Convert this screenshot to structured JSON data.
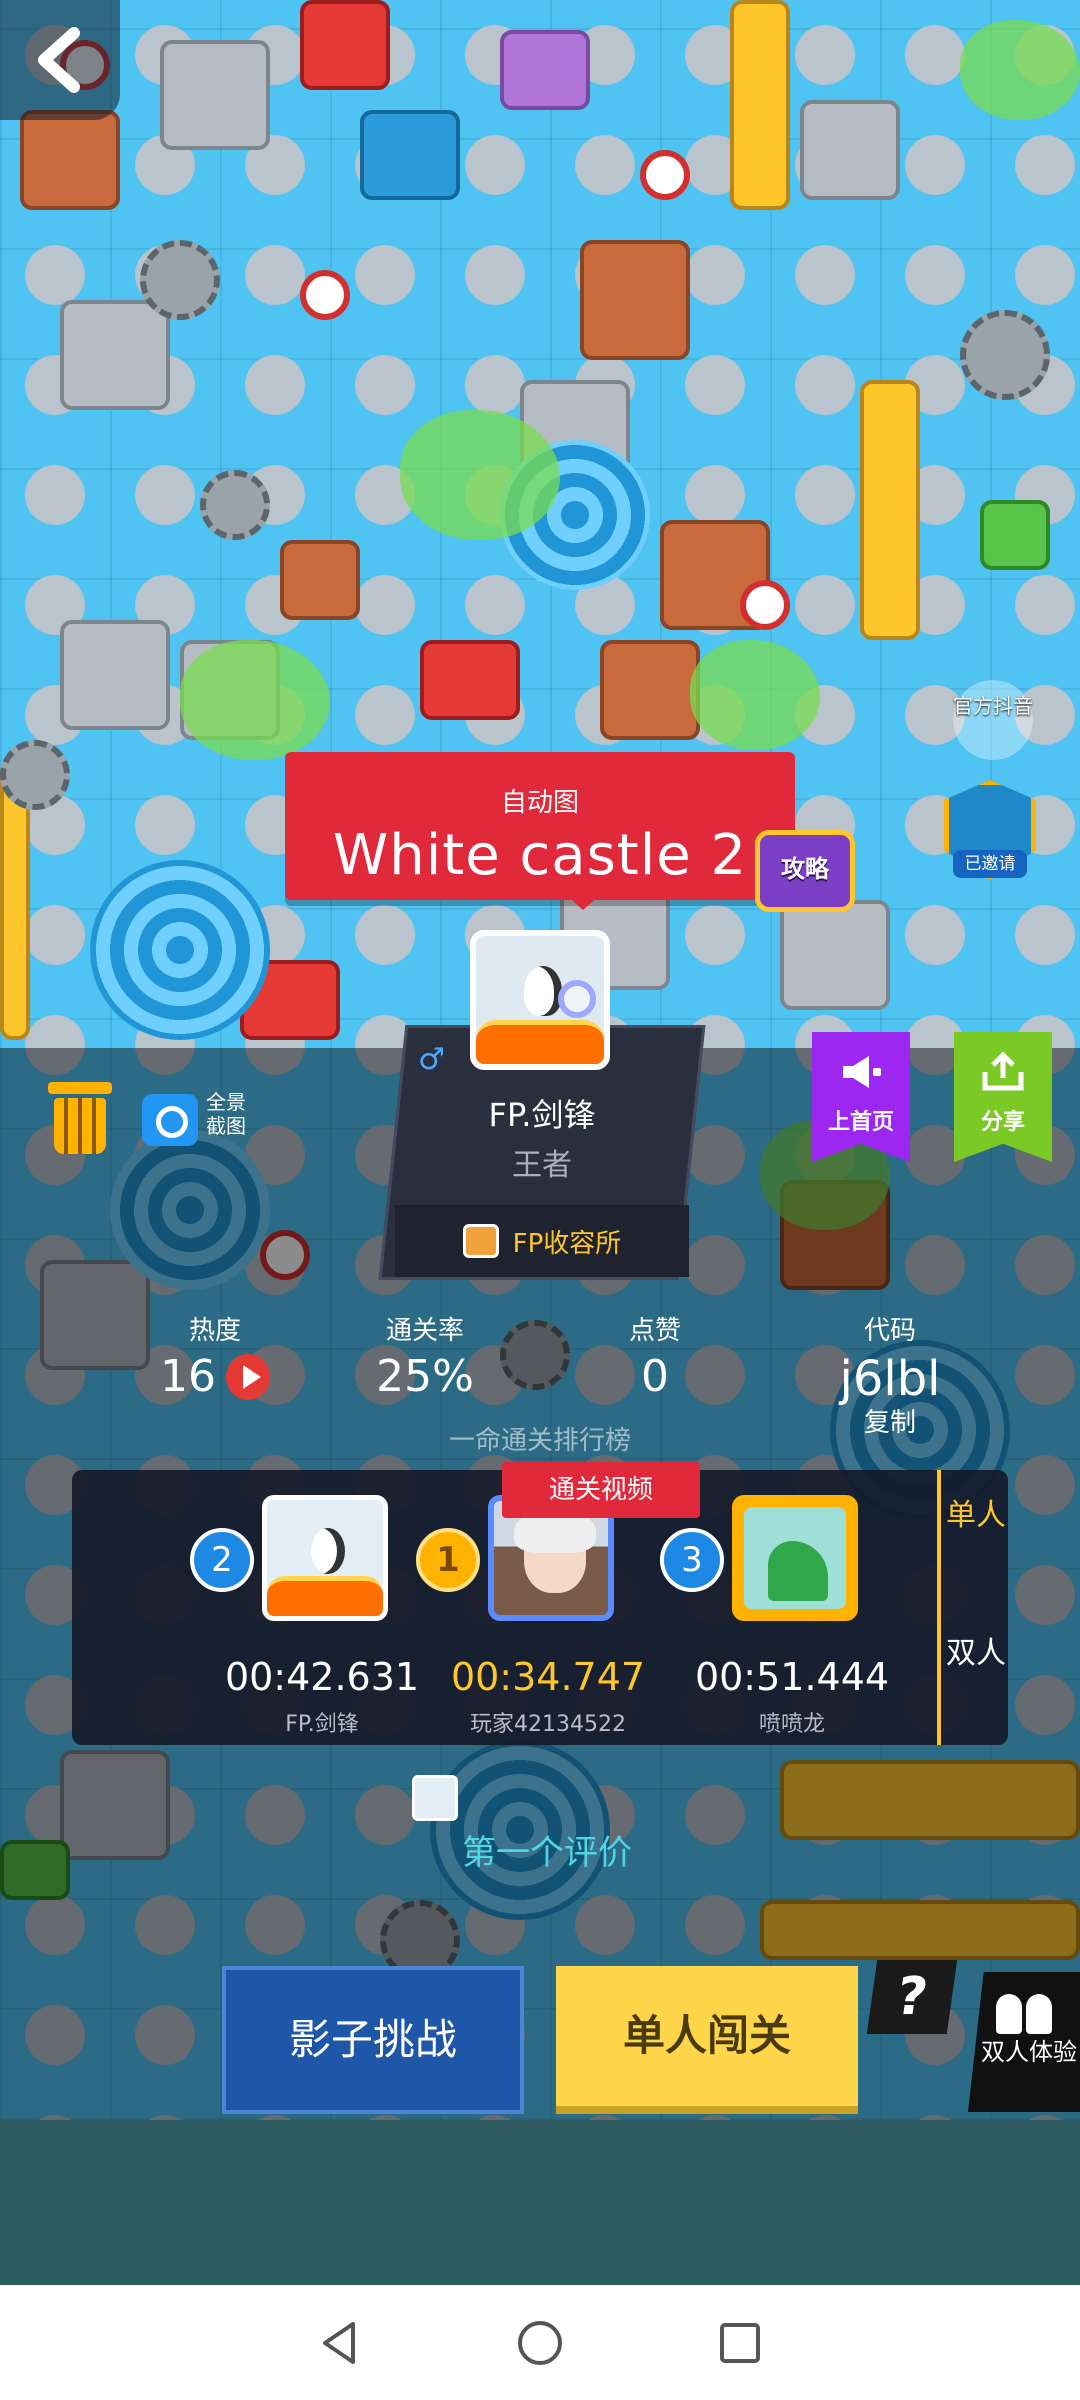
{
  "level": {
    "subtitle": "自动图",
    "title": "White castle 2",
    "guide_label": "攻略"
  },
  "badges": {
    "official": "官方抖音",
    "invited": "已邀请"
  },
  "creator": {
    "name": "FP.剑锋",
    "rank": "王者",
    "club": "FP收容所",
    "gender_symbol": "♂"
  },
  "actions": {
    "screenshot_label": "全景截图",
    "homepage_label": "上首页",
    "share_label": "分享"
  },
  "stats": {
    "heat_label": "热度",
    "heat_value": "16",
    "pass_rate_label": "通关率",
    "pass_rate_value": "25%",
    "likes_label": "点赞",
    "likes_value": "0",
    "code_label": "代码",
    "code_value": "j6lbl",
    "copy_label": "复制"
  },
  "leaderboard": {
    "title": "一命通关排行榜",
    "video_tag": "通关视频",
    "tabs": [
      "单人",
      "双人"
    ],
    "active_tab": "单人",
    "entries": [
      {
        "rank": "2",
        "time": "00:42.631",
        "name": "FP.剑锋"
      },
      {
        "rank": "1",
        "time": "00:34.747",
        "name": "玩家42134522"
      },
      {
        "rank": "3",
        "time": "00:51.444",
        "name": "喷喷龙"
      }
    ]
  },
  "comments": {
    "first_comment": "第一个评价"
  },
  "buttons": {
    "shadow_challenge": "影子挑战",
    "solo_play": "单人闯关",
    "help": "?",
    "duo_trial": "双人体验"
  },
  "colors": {
    "ribbon_red": "#e02a3c",
    "accent_yellow": "#ffc62b",
    "link_cyan": "#4fd6e6",
    "homepage_purple": "#9c27f0",
    "share_green": "#7bc924"
  }
}
